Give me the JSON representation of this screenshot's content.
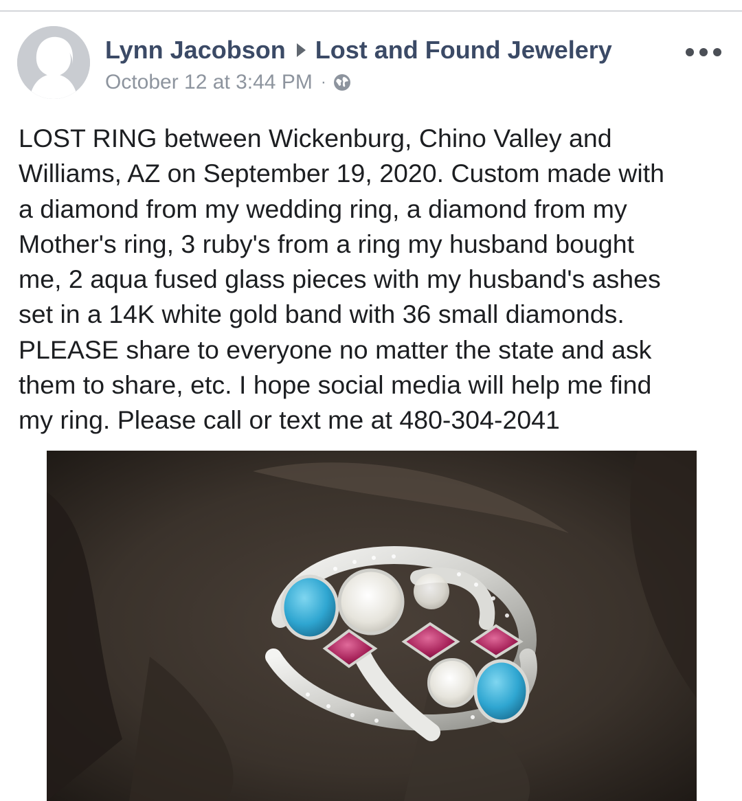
{
  "post": {
    "author": "Lynn Jacobson",
    "group": "Lost and Found Jewelery",
    "timestamp": "October 12 at 3:44 PM",
    "separator": "·",
    "privacy_icon": "globe-icon",
    "more_icon": "more-options-icon",
    "text_lines": [
      "LOST RING between Wickenburg, Chino Valley and",
      "Williams, AZ on September 19, 2020. Custom made with",
      "a diamond from my wedding ring, a diamond from my",
      "Mother's ring, 3 ruby's from a ring my husband bought",
      "me, 2 aqua fused glass pieces with my husband's ashes",
      "set in a 14K white gold band with 36 small diamonds.",
      "PLEASE share to everyone no matter the state and ask",
      "them to share, etc. I hope social media will help me find",
      "my ring. Please call or text me at 480-304-2041"
    ]
  },
  "colors": {
    "name_text": "#3b4a66",
    "meta_text": "#8d949e",
    "body_text": "#1c1e21",
    "avatar_bg": "#c9ccd1"
  }
}
